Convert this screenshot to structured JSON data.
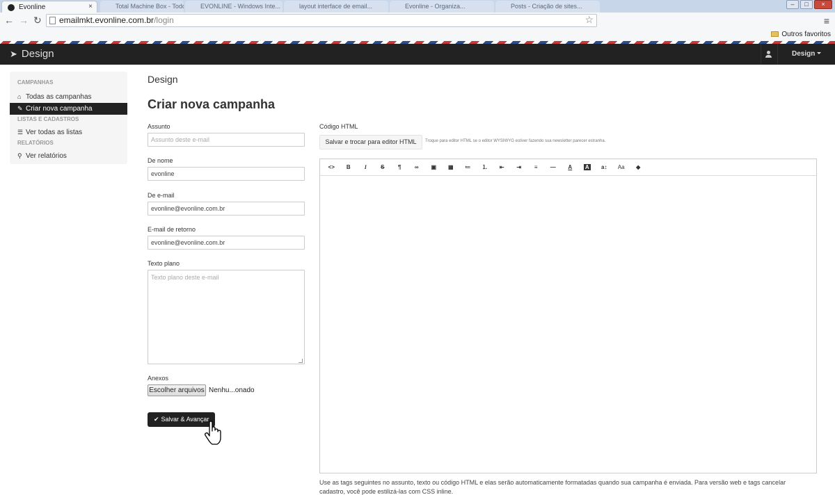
{
  "browser": {
    "active_tab": {
      "title": "Evonline",
      "close": "×"
    },
    "other_tabs": [
      "Total Machine Box - Todo...",
      "EVONLINE - Windows Inte...",
      "layout interface de email...",
      "Evonline - Organiza...",
      "Posts - Criação de sites..."
    ],
    "url_host": "emailmkt.evonline.com.br",
    "url_path": "/login",
    "bookmark_other": "Outros favoritos"
  },
  "navbar": {
    "brand": "Design",
    "user_menu_label": "Design"
  },
  "sidebar": {
    "groups": [
      {
        "header": "CAMPANHAS",
        "items": [
          {
            "icon": "home-icon",
            "label": "Todas as campanhas",
            "active": false
          },
          {
            "icon": "edit-icon",
            "label": "Criar nova campanha",
            "active": true
          }
        ]
      },
      {
        "header": "LISTAS E CADASTROS",
        "items": [
          {
            "icon": "list-icon",
            "label": "Ver todas as listas",
            "active": false
          }
        ]
      },
      {
        "header": "RELATÓRIOS",
        "items": [
          {
            "icon": "search-icon",
            "label": "Ver relatórios",
            "active": false
          }
        ]
      }
    ]
  },
  "main": {
    "section_title": "Design",
    "page_title": "Criar nova campanha",
    "form": {
      "subject_label": "Assunto",
      "subject_placeholder": "Assunto deste e-mail",
      "from_name_label": "De nome",
      "from_name_value": "evonline",
      "from_email_label": "De e-mail",
      "from_email_value": "evonline@evonline.com.br",
      "reply_label": "E-mail de retorno",
      "reply_value": "evonline@evonline.com.br",
      "plain_label": "Texto plano",
      "plain_placeholder": "Texto plano deste e-mail",
      "attachments_label": "Anexos",
      "file_button": "Escolher arquivos",
      "file_status": "Nenhu...onado",
      "submit_label": "Salvar & Avançar"
    },
    "html_editor": {
      "label": "Código HTML",
      "swap_button": "Salvar e trocar para editor HTML",
      "swap_hint": "Troque para editor HTML se o editor WYSIWYG estiver fazendo sua newsletter parecer estranha.",
      "toolbar": [
        "<>",
        "B",
        "I",
        "S",
        "¶",
        "∞",
        "▣",
        "▦",
        "≔",
        "⒈",
        "⇤",
        "⇥",
        "≡",
        "—",
        "A",
        "A",
        "a↕",
        "Aa",
        "◆"
      ]
    },
    "footer_note": "Use as tags seguintes no assunto, texto ou código HTML e elas serão automaticamente formatadas quando sua campanha é enviada. Para versão web e tags cancelar cadastro, você pode estilizá-las com CSS inline."
  },
  "colors": {
    "navbar_bg": "#222222",
    "active_item_bg": "#222222",
    "sidebar_bg": "#f5f5f5"
  }
}
